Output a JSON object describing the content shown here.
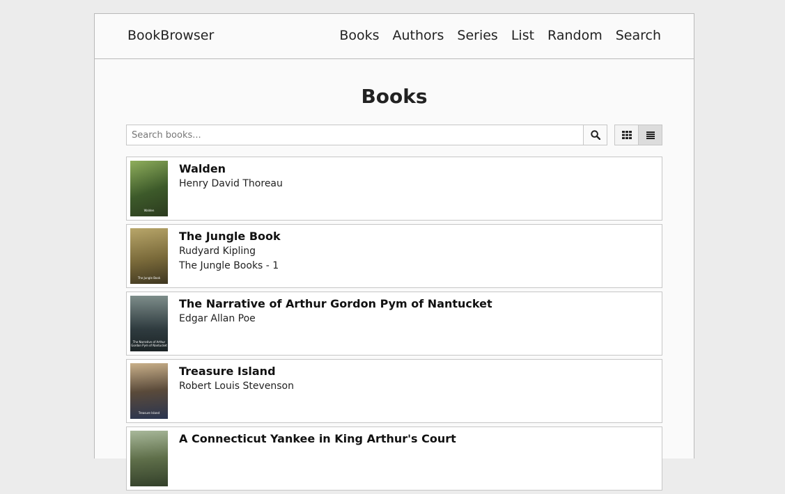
{
  "app": {
    "brand": "BookBrowser"
  },
  "nav": {
    "items": [
      "Books",
      "Authors",
      "Series",
      "List",
      "Random",
      "Search"
    ]
  },
  "page": {
    "title": "Books"
  },
  "search": {
    "placeholder": "Search books...",
    "value": ""
  },
  "icons": {
    "search": "search-icon",
    "grid_view": "grid-view-icon",
    "list_view": "list-view-icon"
  },
  "view_mode": "list",
  "books": [
    {
      "title": "Walden",
      "author": "Henry David Thoreau",
      "series": "",
      "cover_colors": [
        "#3d5a2a",
        "#8fae5c",
        "#2b3a1e"
      ]
    },
    {
      "title": "The Jungle Book",
      "author": "Rudyard Kipling",
      "series": "The Jungle Books - 1",
      "cover_colors": [
        "#7a6a3a",
        "#b8a66a",
        "#3e3620"
      ]
    },
    {
      "title": "The Narrative of Arthur Gordon Pym of Nantucket",
      "author": "Edgar Allan Poe",
      "series": "",
      "cover_colors": [
        "#2f3b3f",
        "#7d8d8a",
        "#1c2426"
      ]
    },
    {
      "title": "Treasure Island",
      "author": "Robert Louis Stevenson",
      "series": "",
      "cover_colors": [
        "#5a4a3a",
        "#c9b08a",
        "#2a3550"
      ]
    },
    {
      "title": "A Connecticut Yankee in King Arthur's Court",
      "author": "",
      "series": "",
      "cover_colors": [
        "#5f6f4a",
        "#a8b89a",
        "#33402a"
      ]
    }
  ]
}
